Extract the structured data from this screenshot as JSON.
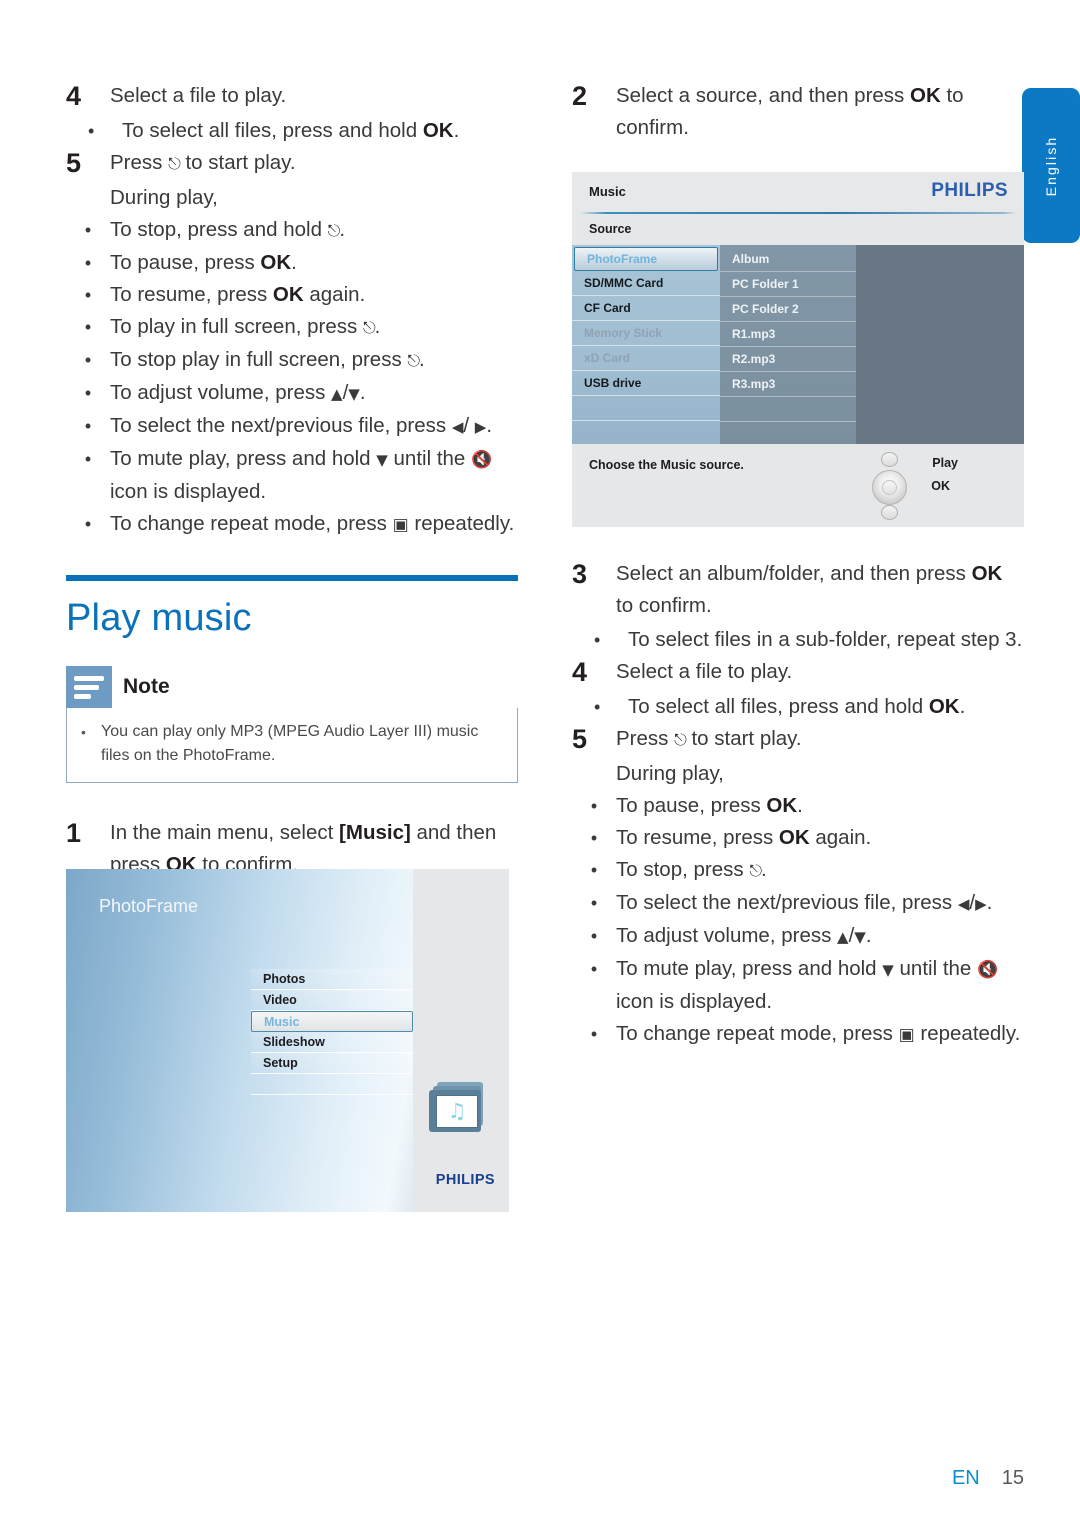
{
  "language_tab": {
    "label": "English"
  },
  "footer": {
    "locale": "EN",
    "page": "15"
  },
  "left_column": {
    "step4": {
      "num": "4",
      "text": "Select a file to play.",
      "bullet": "To select all files, press and hold OK."
    },
    "step5": {
      "num": "5",
      "text_before": "Press",
      "text_after": "to start play.",
      "during": "During play,",
      "bullets": [
        "To stop, press and hold ⌧.",
        "To pause, press OK.",
        "To resume, press OK again.",
        "To play in full screen, press ⌧.",
        "To stop play in full screen, press ⌧.",
        "To adjust volume, press ▲/▼.",
        "To select the next/previous file, press ◀/ ▶.",
        "To mute play, press and hold ▼ until the ✗ icon is displayed.",
        "To change repeat mode, press ≡ repeatedly."
      ]
    },
    "heading": "Play music",
    "note": {
      "title": "Note",
      "body": "You can play only MP3 (MPEG Audio Layer III) music files on the PhotoFrame."
    },
    "step1": {
      "num": "1",
      "text": "In the main menu, select [Music] and then press OK to confirm."
    }
  },
  "screenshot_main_menu": {
    "title": "PhotoFrame",
    "menu_items": [
      "Photos",
      "Video",
      "Music",
      "Slideshow",
      "Setup"
    ],
    "selected_item": "Music",
    "brand": "PHILIPS",
    "icon": "music-folder-icon"
  },
  "right_column": {
    "step2": {
      "num": "2",
      "text": "Select a source, and then press OK to confirm."
    },
    "step3": {
      "num": "3",
      "text": "Select an album/folder, and then press OK to confirm.",
      "bullet": "To select files in a sub-folder, repeat step 3."
    },
    "step4": {
      "num": "4",
      "text": "Select a file to play.",
      "bullet": "To select all files, press and hold OK."
    },
    "step5": {
      "num": "5",
      "text_before": "Press",
      "text_after": "to start play.",
      "during": "During play,",
      "bullets": [
        "To pause, press OK.",
        "To resume, press OK again.",
        "To stop, press ⌧.",
        "To select the next/previous file, press ◀/▶.",
        "To adjust volume, press ▲/▼.",
        "To mute play, press and hold ▼ until the ✗ icon is displayed.",
        "To change repeat mode, press ≡ repeatedly."
      ]
    }
  },
  "screenshot_source": {
    "header_title": "Music",
    "brand": "PHILIPS",
    "sub_title": "Source",
    "source_list": [
      {
        "label": "PhotoFrame",
        "state": "selected"
      },
      {
        "label": "SD/MMC Card",
        "state": "normal"
      },
      {
        "label": "CF Card",
        "state": "normal"
      },
      {
        "label": "Memory Stick",
        "state": "disabled"
      },
      {
        "label": "xD Card",
        "state": "disabled"
      },
      {
        "label": "USB drive",
        "state": "normal"
      }
    ],
    "album_list": [
      "Album",
      "PC Folder 1",
      "PC Folder 2",
      "R1.mp3",
      "R2.mp3",
      "R3.mp3"
    ],
    "hint": "Choose the Music source.",
    "button_play": "Play",
    "button_ok": "OK"
  },
  "colors": {
    "accent_blue": "#0b71b8",
    "tab_blue": "#0b79c4",
    "footer_blue": "#0b8fd4",
    "note_icon": "#6d9bc3",
    "philips_blue": "#2b5fae"
  }
}
